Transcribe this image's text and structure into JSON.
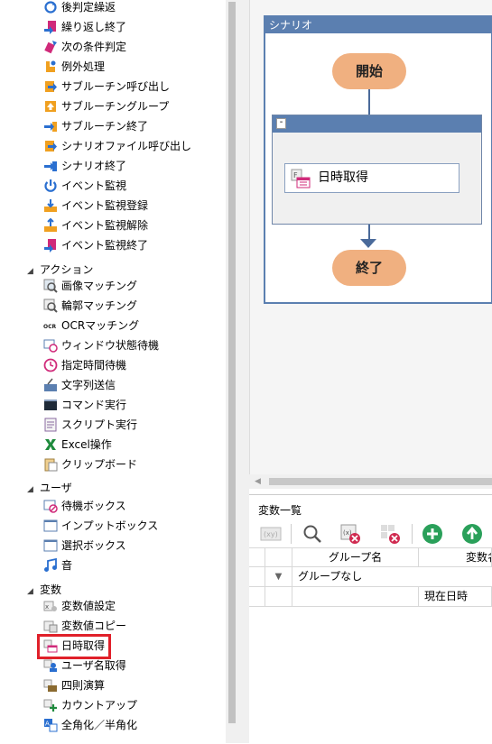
{
  "tree": {
    "control_items": [
      {
        "label": "後判定繰返",
        "icon": "loop-after-icon"
      },
      {
        "label": "繰り返し終了",
        "icon": "loop-end-icon"
      },
      {
        "label": "次の条件判定",
        "icon": "next-condition-icon"
      },
      {
        "label": "例外処理",
        "icon": "exception-icon"
      },
      {
        "label": "サブルーチン呼び出し",
        "icon": "subroutine-call-icon"
      },
      {
        "label": "サブルーチングループ",
        "icon": "subroutine-group-icon"
      },
      {
        "label": "サブルーチン終了",
        "icon": "subroutine-end-icon"
      },
      {
        "label": "シナリオファイル呼び出し",
        "icon": "scenario-call-icon"
      },
      {
        "label": "シナリオ終了",
        "icon": "scenario-end-icon"
      },
      {
        "label": "イベント監視",
        "icon": "event-monitor-icon"
      },
      {
        "label": "イベント監視登録",
        "icon": "event-register-icon"
      },
      {
        "label": "イベント監視解除",
        "icon": "event-unregister-icon"
      },
      {
        "label": "イベント監視終了",
        "icon": "event-monitor-end-icon"
      }
    ],
    "action_category": "アクション",
    "action_items": [
      {
        "label": "画像マッチング",
        "icon": "image-match-icon"
      },
      {
        "label": "輪郭マッチング",
        "icon": "contour-match-icon"
      },
      {
        "label": "OCRマッチング",
        "icon": "ocr-icon"
      },
      {
        "label": "ウィンドウ状態待機",
        "icon": "window-wait-icon"
      },
      {
        "label": "指定時間待機",
        "icon": "clock-icon"
      },
      {
        "label": "文字列送信",
        "icon": "text-send-icon"
      },
      {
        "label": "コマンド実行",
        "icon": "command-icon"
      },
      {
        "label": "スクリプト実行",
        "icon": "script-icon"
      },
      {
        "label": "Excel操作",
        "icon": "excel-icon"
      },
      {
        "label": "クリップボード",
        "icon": "clipboard-icon"
      }
    ],
    "user_category": "ユーザ",
    "user_items": [
      {
        "label": "待機ボックス",
        "icon": "wait-box-icon"
      },
      {
        "label": "インプットボックス",
        "icon": "input-box-icon"
      },
      {
        "label": "選択ボックス",
        "icon": "select-box-icon"
      },
      {
        "label": "音",
        "icon": "music-icon"
      }
    ],
    "variable_category": "変数",
    "variable_items": [
      {
        "label": "変数値設定",
        "icon": "var-set-icon"
      },
      {
        "label": "変数値コピー",
        "icon": "var-copy-icon"
      },
      {
        "label": "日時取得",
        "icon": "datetime-icon"
      },
      {
        "label": "ユーザ名取得",
        "icon": "username-icon"
      },
      {
        "label": "四則演算",
        "icon": "calc-icon"
      },
      {
        "label": "カウントアップ",
        "icon": "countup-icon"
      },
      {
        "label": "全角化／半角化",
        "icon": "width-convert-icon"
      }
    ]
  },
  "flow": {
    "scenario_title": "シナリオ",
    "start_label": "開始",
    "end_label": "終了",
    "block_collapse": "-",
    "action_label": "日時取得"
  },
  "variables": {
    "title": "変数一覧",
    "columns": [
      "グループ名",
      "変数名"
    ],
    "group_row": "グループなし",
    "var_row_name": "現在日時"
  },
  "colors": {
    "scenario_header": "#5b7fb0",
    "terminal": "#f0b080",
    "highlight": "#e0202a"
  }
}
